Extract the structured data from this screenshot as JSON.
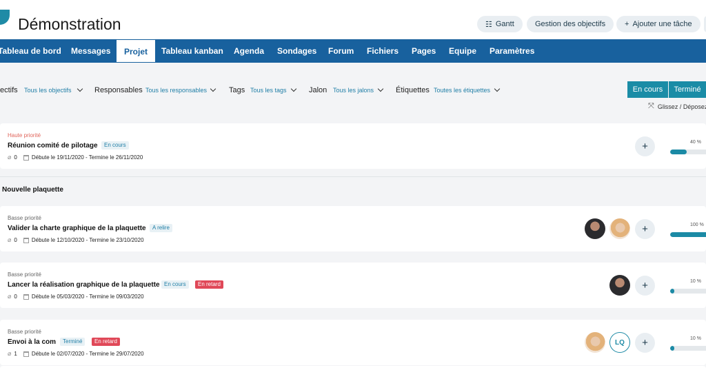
{
  "header": {
    "title": "Démonstration",
    "buttons": [
      {
        "label": "Gantt",
        "icon": "list-icon"
      },
      {
        "label": "Gestion des objectifs"
      },
      {
        "label": "Ajouter une tâche",
        "icon": "plus-icon"
      }
    ]
  },
  "nav": {
    "items": [
      "Tableau de bord",
      "Messages",
      "Projet",
      "Tableau kanban",
      "Agenda",
      "Sondages",
      "Forum",
      "Fichiers",
      "Pages",
      "Equipe",
      "Paramètres"
    ],
    "active": "Projet"
  },
  "filters": [
    {
      "label": "ectifs",
      "value": "Tous les objectifs"
    },
    {
      "label": "Responsables",
      "value": "Tous les responsables"
    },
    {
      "label": "Tags",
      "value": "Tous les tags"
    },
    {
      "label": "Jalon",
      "value": "Tous les jalons"
    },
    {
      "label": "Étiquettes",
      "value": "Toutes les étiquettes"
    }
  ],
  "status_toggle": {
    "options": [
      "En cours",
      "Terminé"
    ]
  },
  "drag_hint": "Glissez / Déposez",
  "section_title": "Nouvelle plaquette",
  "tasks": [
    {
      "priority": "Haute priorité",
      "name": "Réunion comité de pilotage",
      "badges": [
        "En cours"
      ],
      "attachments": "0",
      "dates": "Débute le 19/11/2020 - Termine le 26/11/2020",
      "progress_label": "40 %",
      "progress": 0.4
    },
    {
      "priority": "Basse priorité",
      "name": "Valider la charte graphique de la plaquette",
      "badges": [
        "A relire"
      ],
      "attachments": "0",
      "dates": "Débute le 12/10/2020 - Termine le 23/10/2020",
      "progress_label": "100 %",
      "progress": 1.0
    },
    {
      "priority": "Basse priorité",
      "name": "Lancer la réalisation graphique de la plaquette",
      "badges": [
        "En cours",
        "En retard"
      ],
      "attachments": "0",
      "dates": "Débute le 05/03/2020 - Termine le 09/03/2020",
      "progress_label": "10 %",
      "progress": 0.1
    },
    {
      "priority": "Basse priorité",
      "name": "Envoi à la com",
      "badges": [
        "Terminé",
        "En retard"
      ],
      "attachments": "1",
      "dates": "Débute le 02/07/2020 - Termine le 29/07/2020",
      "progress_label": "10 %",
      "progress": 0.1,
      "avatar_initials": "LQ"
    }
  ],
  "colors": {
    "nav": "#18619e",
    "accent": "#1a8ca6",
    "late": "#e04858"
  }
}
